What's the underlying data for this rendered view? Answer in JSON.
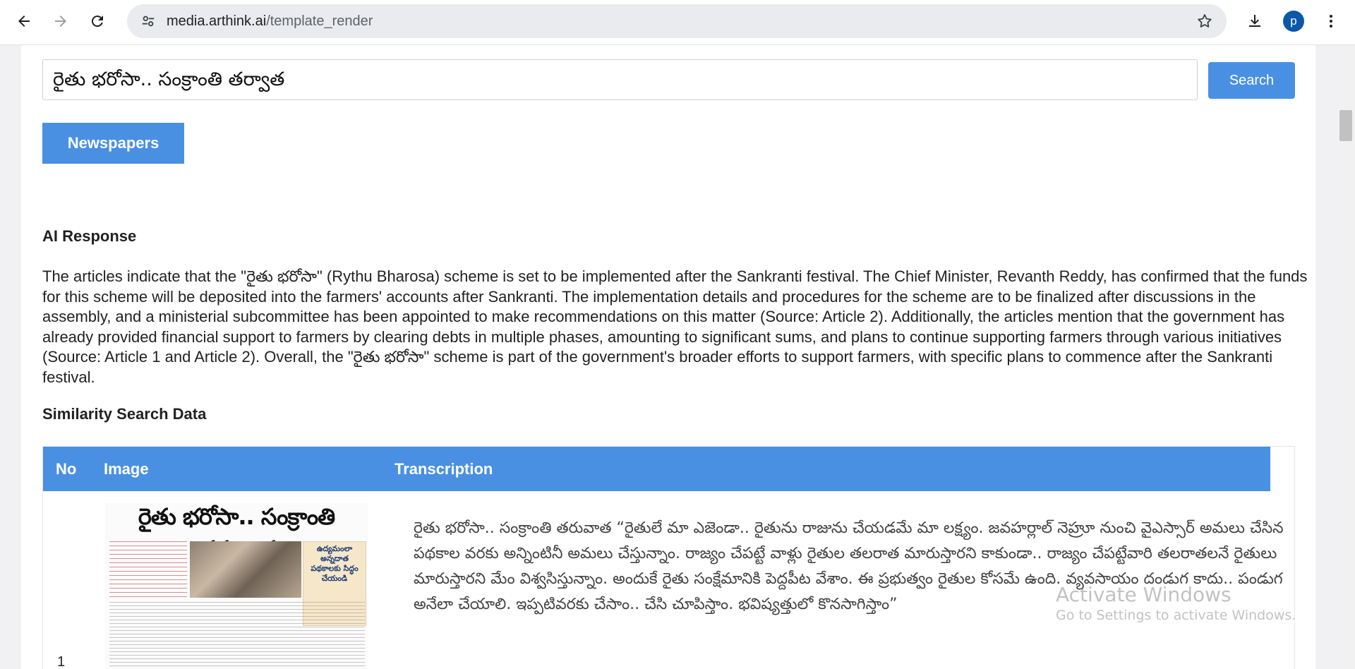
{
  "browser": {
    "url_host": "media.arthink.ai",
    "url_path": "/template_render",
    "profile_initial": "p"
  },
  "search": {
    "value": "రైతు భరోసా.. సంక్రాంతి తర్వాత",
    "button_label": "Search"
  },
  "newspapers_button": "Newspapers",
  "ai_response": {
    "title": "AI Response",
    "text": "The articles indicate that the \"రైతు భరోసా\" (Rythu Bharosa) scheme is set to be implemented after the Sankranti festival. The Chief Minister, Revanth Reddy, has confirmed that the funds for this scheme will be deposited into the farmers' accounts after Sankranti. The implementation details and procedures for the scheme are to be finalized after discussions in the assembly, and a ministerial subcommittee has been appointed to make recommendations on this matter (Source: Article 2). Additionally, the articles mention that the government has already provided financial support to farmers by clearing debts in multiple phases, amounting to significant sums, and plans to continue supporting farmers through various initiatives (Source: Article 1 and Article 2). Overall, the \"రైతు భరోసా\" scheme is part of the government's broader efforts to support farmers, with specific plans to commence after the Sankranti festival."
  },
  "similarity": {
    "title": "Similarity Search Data",
    "columns": [
      "No",
      "Image",
      "Transcription"
    ],
    "rows": [
      {
        "no": "1",
        "image_headline": "రైతు భరోసా.. సంక్రాంతి తరువాత",
        "image_subhead": "ఉద్యమంలా అన్నదాత పథకాలకు సిద్ధం చేయండి",
        "transcription": "రైతు భరోసా.. సంక్రాంతి తరువాత “రైతులే మా ఎజెండా.. రైతును రాజును చేయడమే మా లక్ష్యం. జవహర్లాల్ నెహ్రూ నుంచి వైఎస్సార్ అమలు చేసిన పథకాల వరకు అన్నింటినీ అమలు చేస్తున్నాం. రాజ్యం చేపట్టే వాళ్లు రైతుల తలరాత మారుస్తారని కాకుండా.. రాజ్యం చేపట్టేవారి తలరాతలనే రైతులు మారుస్తారని మేం విశ్వసిస్తున్నాం. అందుకే రైతు సంక్షేమానికి పెద్దపీట వేశాం. ఈ ప్రభుత్వం రైతుల కోసమే ఉంది. వ్యవసాయం దండుగ కాదు.. పండుగ అనేలా చేయాలి. ఇప్పటివరకు చేసాం.. చేసి చూపిస్తాం. భవిష్యత్తులో కొనసాగిస్తాం”"
      }
    ]
  },
  "os_watermark": {
    "line1": "Activate Windows",
    "line2": "Go to Settings to activate Windows."
  }
}
